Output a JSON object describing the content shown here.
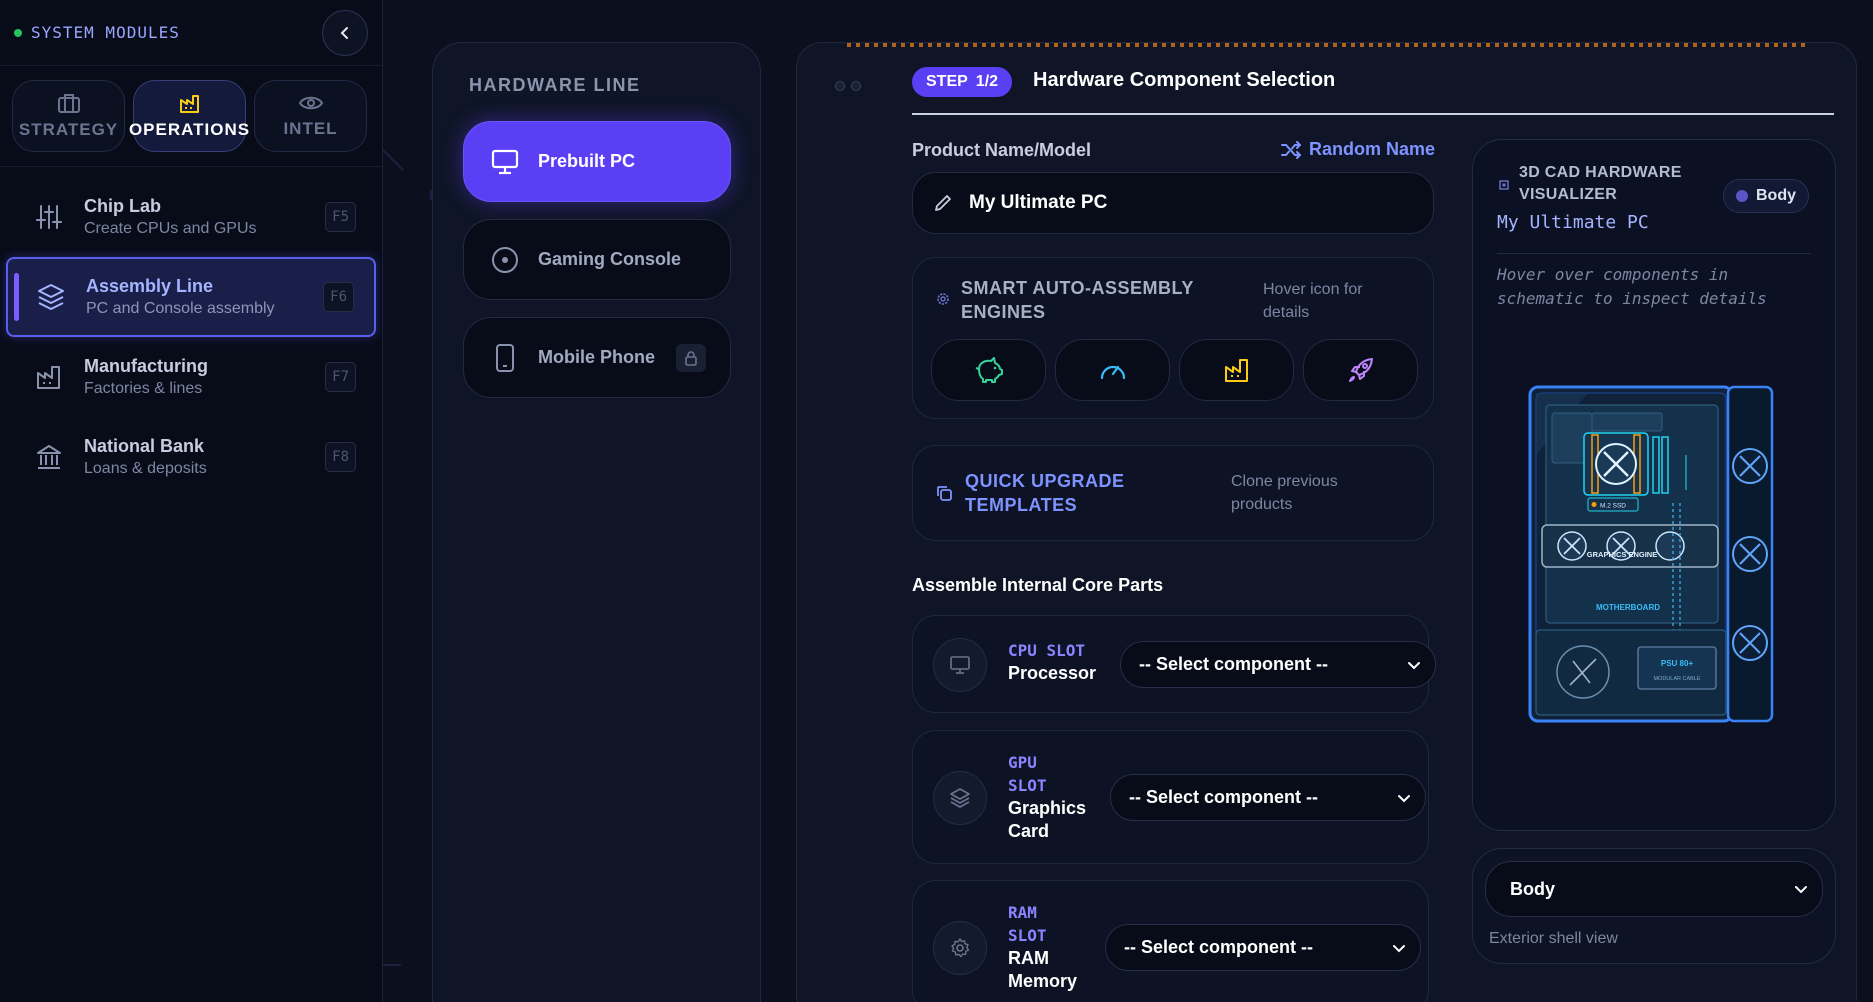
{
  "sidebar": {
    "title": "SYSTEM MODULES",
    "tabs": [
      {
        "label": "STRATEGY",
        "icon": "briefcase-icon"
      },
      {
        "label": "OPERATIONS",
        "icon": "factory-icon"
      },
      {
        "label": "INTEL",
        "icon": "eye-icon"
      }
    ],
    "items": [
      {
        "title": "Chip Lab",
        "subtitle": "Create CPUs and GPUs",
        "key": "F5",
        "icon": "sliders-icon"
      },
      {
        "title": "Assembly Line",
        "subtitle": "PC and Console assembly",
        "key": "F6",
        "icon": "layers-icon"
      },
      {
        "title": "Manufacturing",
        "subtitle": "Factories & lines",
        "key": "F7",
        "icon": "factory-icon"
      },
      {
        "title": "National Bank",
        "subtitle": "Loans & deposits",
        "key": "F8",
        "icon": "bank-icon"
      }
    ]
  },
  "hardware_line": {
    "label": "HARDWARE LINE",
    "options": [
      {
        "label": "Prebuilt PC",
        "icon": "monitor-icon"
      },
      {
        "label": "Gaming Console",
        "icon": "disc-icon"
      },
      {
        "label": "Mobile Phone",
        "icon": "smartphone-icon",
        "locked": true
      }
    ]
  },
  "main": {
    "step_word": "STEP",
    "step_value": "1/2",
    "title": "Hardware Component Selection",
    "name_label": "Product Name/Model",
    "random_label": "Random Name",
    "name_value": "My Ultimate PC",
    "engines": {
      "title_line1": "SMART AUTO-ASSEMBLY",
      "title_line2": "ENGINES",
      "hint_line1": "Hover icon for",
      "hint_line2": "details",
      "buttons": [
        "piggy-bank-icon",
        "gauge-icon",
        "factory-icon",
        "rocket-icon"
      ]
    },
    "templates": {
      "title_line1": "QUICK UPGRADE",
      "title_line2": "TEMPLATES",
      "hint_line1": "Clone previous",
      "hint_line2": "products"
    },
    "section_title": "Assemble Internal Core Parts",
    "slots": [
      {
        "tag": "CPU SLOT",
        "name": "Processor",
        "value": "-- Select component --",
        "icon": "monitor-icon"
      },
      {
        "tag_line1": "GPU",
        "tag_line2": "SLOT",
        "name_line1": "Graphics",
        "name_line2": "Card",
        "value": "-- Select component --",
        "icon": "layers-icon"
      },
      {
        "tag_line1": "RAM",
        "tag_line2": "SLOT",
        "name_line1": "RAM",
        "name_line2": "Memory",
        "value": "-- Select component --",
        "icon": "gear-icon"
      }
    ]
  },
  "visualizer": {
    "title_line1": "3D CAD HARDWARE",
    "title_line2": "VISUALIZER",
    "badge": "Body",
    "model": "My Ultimate PC",
    "hint_line1": "Hover over components in",
    "hint_line2": "schematic to inspect details",
    "labels": {
      "ssd": "M.2 SSD",
      "gpu": "GRAPHICS ENGINE",
      "mobo": "MOTHERBOARD",
      "psu": "PSU 80+",
      "psu_sub": "MODULAR CABLE"
    },
    "view_select": "Body",
    "view_hint": "Exterior shell view"
  },
  "colors": {
    "accent": "#5a3ff5",
    "accent_text": "#7e93ff",
    "status_dot": "#22c55e",
    "schematic": "#3b82f6"
  }
}
